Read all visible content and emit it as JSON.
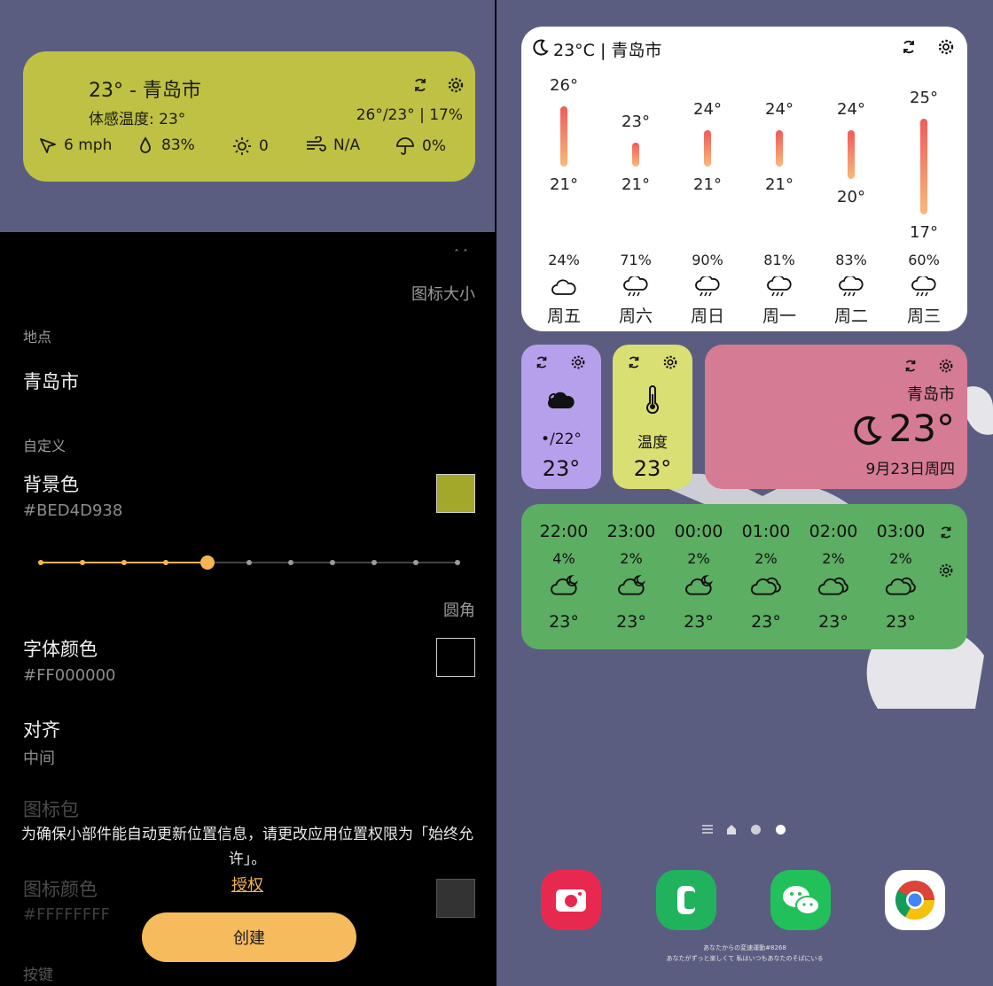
{
  "preview": {
    "title": "23° - 青岛市",
    "feels_like": "体感温度: 23°",
    "range": "26°/23° | 17%",
    "wind": "6 mph",
    "humidity": "83%",
    "uv": "0",
    "air": "N/A",
    "rain": "0%",
    "bg_color": "#BEC143"
  },
  "settings": {
    "icon_size_label": "图标大小",
    "location_section": "地点",
    "location_value": "青岛市",
    "custom_section": "自定义",
    "bg_color_label": "背景色",
    "bg_color_value": "#BED4D938",
    "bg_swatch_color": "#A3A72A",
    "corner_label": "圆角",
    "corner_level": 5,
    "corner_steps": 11,
    "font_color_label": "字体颜色",
    "font_color_value": "#FF000000",
    "align_label": "对齐",
    "align_value": "中间",
    "icon_pack_label": "图标包",
    "icon_color_label": "图标颜色",
    "icon_color_value": "#FFFFFFFF",
    "buttons_label": "按键",
    "permission_msg": "为确保小部件能自动更新位置信息，请更改应用位置权限为「始终允许」。",
    "grant_label": "授权",
    "create_label": "创建",
    "accent_color": "#F6B554"
  },
  "forecast": {
    "header": "23°C | 青岛市",
    "days": [
      {
        "high": "26°",
        "low": "21°",
        "precip": "24%",
        "day": "周五",
        "icon": "cloud-icon"
      },
      {
        "high": "23°",
        "low": "21°",
        "precip": "71%",
        "day": "周六",
        "icon": "rain-cloud-icon"
      },
      {
        "high": "24°",
        "low": "21°",
        "precip": "90%",
        "day": "周日",
        "icon": "rain-cloud-icon"
      },
      {
        "high": "24°",
        "low": "21°",
        "precip": "81%",
        "day": "周一",
        "icon": "rain-cloud-icon"
      },
      {
        "high": "24°",
        "low": "20°",
        "precip": "83%",
        "day": "周二",
        "icon": "rain-cloud-icon"
      },
      {
        "high": "25°",
        "low": "17°",
        "precip": "60%",
        "day": "周三",
        "icon": "rain-cloud-icon"
      }
    ]
  },
  "small_widgets": {
    "purple": {
      "range": "•/22°",
      "temp": "23°",
      "color": "#B7A0EB"
    },
    "yellow": {
      "label": "温度",
      "temp": "23°",
      "color": "#D9DF72"
    },
    "pink": {
      "city": "青岛市",
      "temp": "23°",
      "date": "9月23日周四",
      "color": "#D57B94"
    }
  },
  "hourly": {
    "color": "#5CAE62",
    "hours": [
      {
        "time": "22:00",
        "precip": "4%",
        "temp": "23°",
        "icon": "partly-cloudy-night-icon"
      },
      {
        "time": "23:00",
        "precip": "2%",
        "temp": "23°",
        "icon": "partly-cloudy-night-icon"
      },
      {
        "time": "00:00",
        "precip": "2%",
        "temp": "23°",
        "icon": "partly-cloudy-night-icon"
      },
      {
        "time": "01:00",
        "precip": "2%",
        "temp": "23°",
        "icon": "cloudy-icon"
      },
      {
        "time": "02:00",
        "precip": "2%",
        "temp": "23°",
        "icon": "cloudy-icon"
      },
      {
        "time": "03:00",
        "precip": "2%",
        "temp": "23°",
        "icon": "cloudy-icon"
      }
    ]
  },
  "home": {
    "dock_apps": [
      {
        "name": "screen-recorder-app",
        "color": "#E8294F"
      },
      {
        "name": "phone-app",
        "color": "#20B25C"
      },
      {
        "name": "wechat-app",
        "color": "#22C05A"
      },
      {
        "name": "chrome-app",
        "color": "#FFFFFF"
      }
    ],
    "footer_line1": "あなたからの変速運動#8268",
    "footer_line2": "あなたがずっと楽しくて 私はいつもあなたのそばにいる"
  }
}
